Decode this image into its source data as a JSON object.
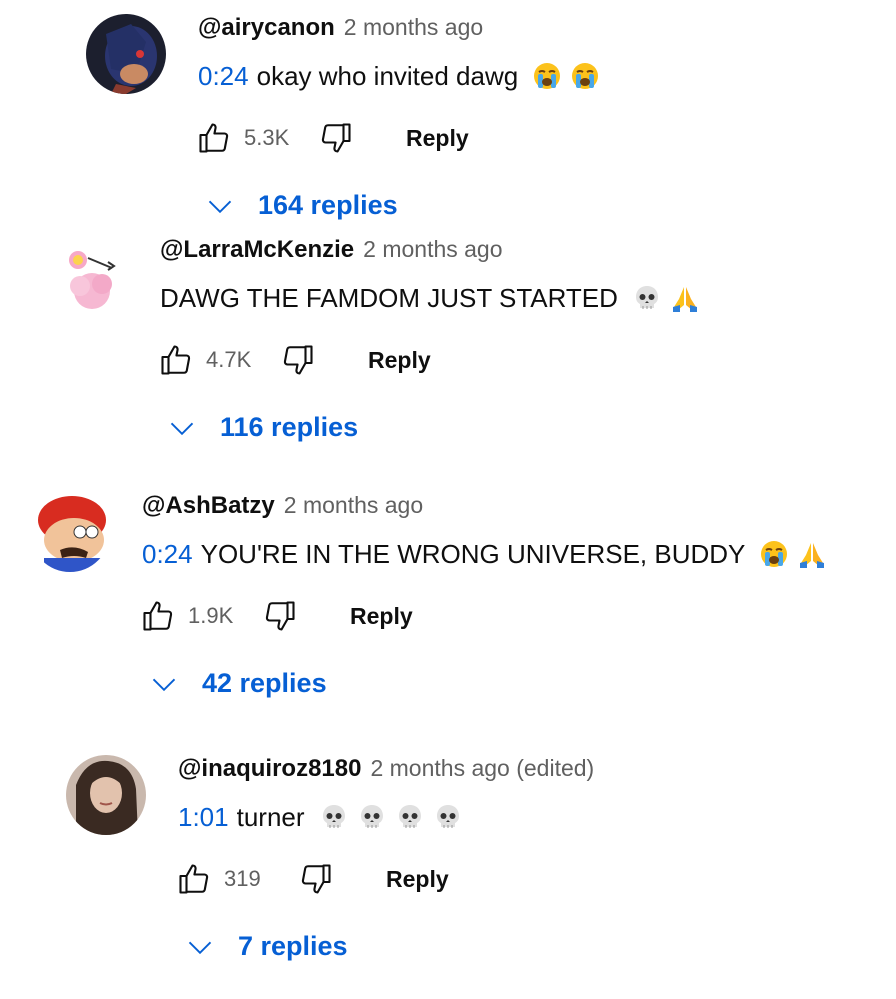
{
  "accent_color": "#065fd4",
  "comments": [
    {
      "author": "@airycanon",
      "time": "2 months ago",
      "timestamp": "0:24",
      "text": "okay who invited dawg",
      "emojis": [
        "loudly-crying-face",
        "loudly-crying-face"
      ],
      "likes": "5.3K",
      "reply_label": "Reply",
      "replies_label": "164 replies",
      "avatar": "dark-hedgehog-avatar"
    },
    {
      "author": "@LarraMcKenzie",
      "time": "2 months ago",
      "timestamp": "",
      "text": "DAWG THE FAMDOM JUST STARTED",
      "emojis": [
        "skull",
        "folded-hands"
      ],
      "likes": "4.7K",
      "reply_label": "Reply",
      "replies_label": "116 replies",
      "avatar": "pink-flower-avatar"
    },
    {
      "author": "@AshBatzy",
      "time": "2 months ago",
      "timestamp": "0:24",
      "text": "YOU'RE IN THE WRONG UNIVERSE, BUDDY",
      "emojis": [
        "loudly-crying-face",
        "folded-hands"
      ],
      "likes": "1.9K",
      "reply_label": "Reply",
      "replies_label": "42 replies",
      "avatar": "mario-avatar"
    },
    {
      "author": "@inaquiroz8180",
      "time": "2 months ago (edited)",
      "timestamp": "1:01",
      "text": "turner",
      "emojis": [
        "skull",
        "skull",
        "skull",
        "skull"
      ],
      "likes": "319",
      "reply_label": "Reply",
      "replies_label": "7 replies",
      "avatar": "photo-avatar"
    }
  ]
}
